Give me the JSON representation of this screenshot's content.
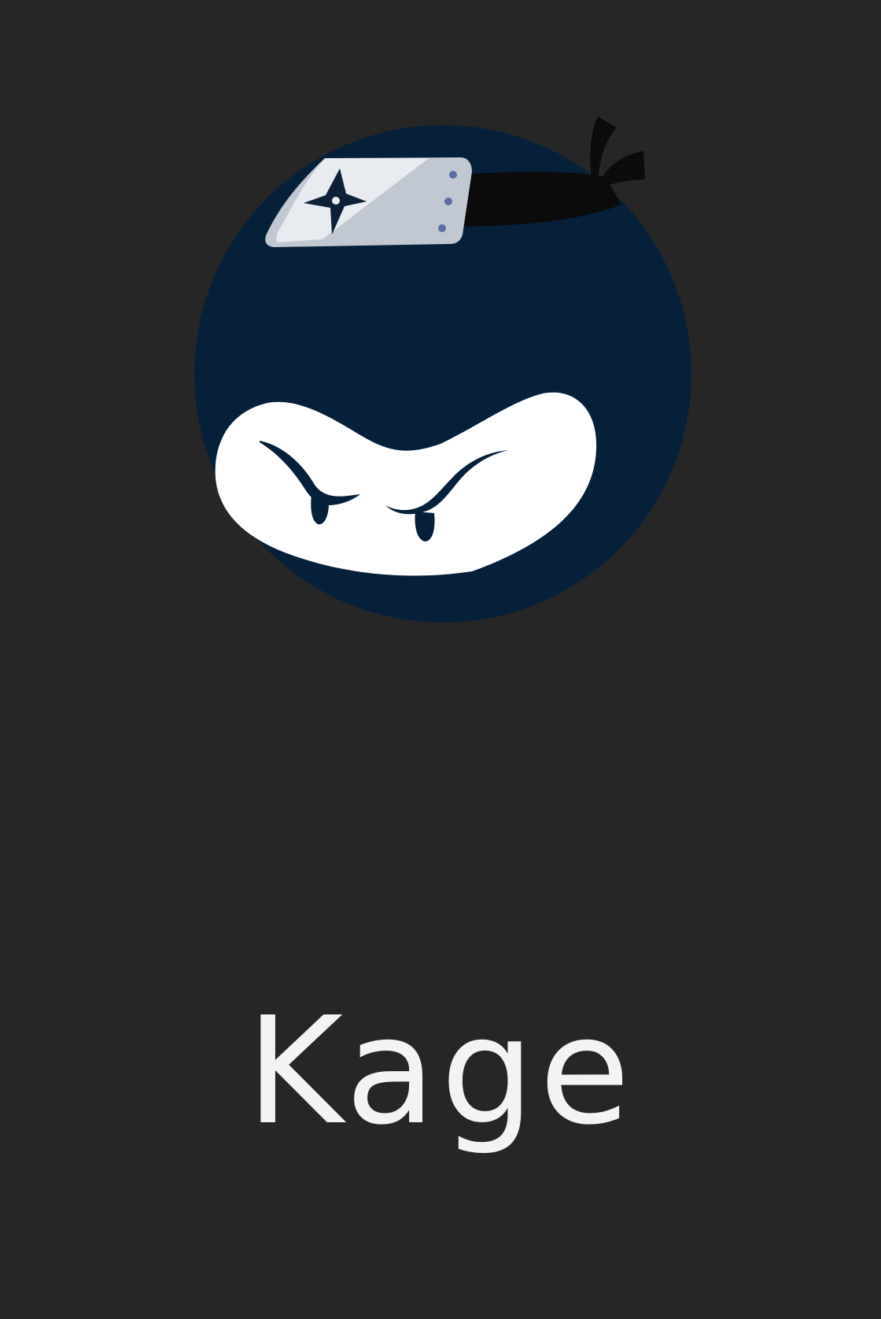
{
  "app": {
    "name": "Kage"
  },
  "logo": {
    "icon": "ninja-mascot-icon",
    "colors": {
      "background": "#262626",
      "face": "#06203a",
      "mask_opening": "#ffffff",
      "headband_plate": "#c2c8d2",
      "headband_cloth": "#0b0b0b",
      "rivets": "#5b6ea0",
      "text": "#f3f3f3"
    }
  }
}
